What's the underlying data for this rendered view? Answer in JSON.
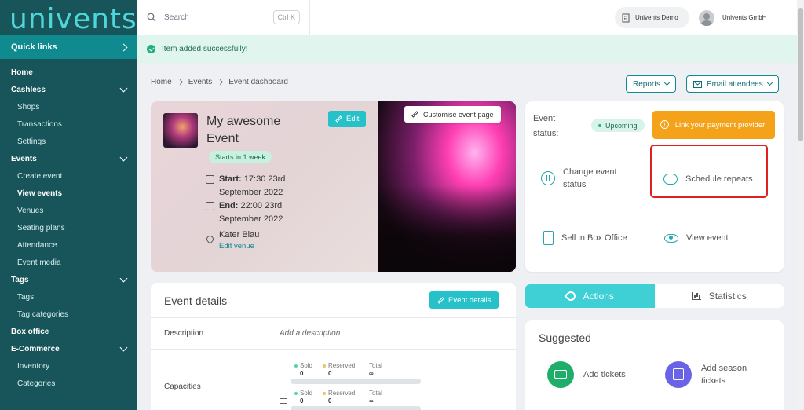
{
  "sidebar": {
    "logo": "univents",
    "quick_links": "Quick links",
    "items": [
      {
        "label": "Home",
        "type": "section"
      },
      {
        "label": "Cashless",
        "type": "section",
        "chevron": true
      },
      {
        "label": "Shops",
        "type": "sub"
      },
      {
        "label": "Transactions",
        "type": "sub"
      },
      {
        "label": "Settings",
        "type": "sub"
      },
      {
        "label": "Events",
        "type": "section",
        "chevron": true
      },
      {
        "label": "Create event",
        "type": "sub"
      },
      {
        "label": "View events",
        "type": "sub",
        "active": true
      },
      {
        "label": "Venues",
        "type": "sub"
      },
      {
        "label": "Seating plans",
        "type": "sub"
      },
      {
        "label": "Attendance",
        "type": "sub"
      },
      {
        "label": "Event media",
        "type": "sub"
      },
      {
        "label": "Tags",
        "type": "section",
        "chevron": true
      },
      {
        "label": "Tags",
        "type": "sub"
      },
      {
        "label": "Tag categories",
        "type": "sub"
      },
      {
        "label": "Box office",
        "type": "section"
      },
      {
        "label": "E-Commerce",
        "type": "section",
        "chevron": true
      },
      {
        "label": "Inventory",
        "type": "sub"
      },
      {
        "label": "Categories",
        "type": "sub"
      }
    ]
  },
  "topbar": {
    "search_placeholder": "Search",
    "shortcut": "Ctrl K",
    "org": "Univents Demo",
    "user": "Univents GmbH"
  },
  "alert": "Item added successfully!",
  "breadcrumb": [
    "Home",
    "Events",
    "Event dashboard"
  ],
  "buttons": {
    "reports": "Reports",
    "email_attendees": "Email attendees"
  },
  "event": {
    "title": "My awesome Event",
    "starts_badge": "Starts in 1 week",
    "start_label": "Start:",
    "start_value": "17:30 23rd September 2022",
    "end_label": "End:",
    "end_value": "22:00 23rd September 2022",
    "venue": "Kater Blau",
    "edit_venue": "Edit venue",
    "edit": "Edit",
    "customise": "Customise event page"
  },
  "status": {
    "label": "Event status:",
    "badge": "Upcoming",
    "link_payment": "Link your payment provider",
    "actions": {
      "change_status": "Change event status",
      "schedule_repeats": "Schedule repeats",
      "box_office": "Sell in Box Office",
      "view_event": "View event"
    }
  },
  "tabs": {
    "actions": "Actions",
    "statistics": "Statistics"
  },
  "suggested": {
    "title": "Suggested",
    "add_tickets": "Add tickets",
    "add_season": "Add season tickets"
  },
  "details": {
    "title": "Event details",
    "button": "Event details",
    "description_label": "Description",
    "description_placeholder": "Add a description",
    "capacities_label": "Capacities",
    "sold_label": "Sold",
    "reserved_label": "Reserved",
    "total_label": "Total",
    "rows": [
      {
        "sold": "0",
        "reserved": "0",
        "total": "∞"
      },
      {
        "sold": "0",
        "reserved": "0",
        "total": "∞"
      }
    ]
  },
  "colors": {
    "sidebar": "#17555a",
    "accent": "#26c1c9",
    "warning": "#f5a21b",
    "success": "#22b07d",
    "highlight": "#e02020"
  }
}
